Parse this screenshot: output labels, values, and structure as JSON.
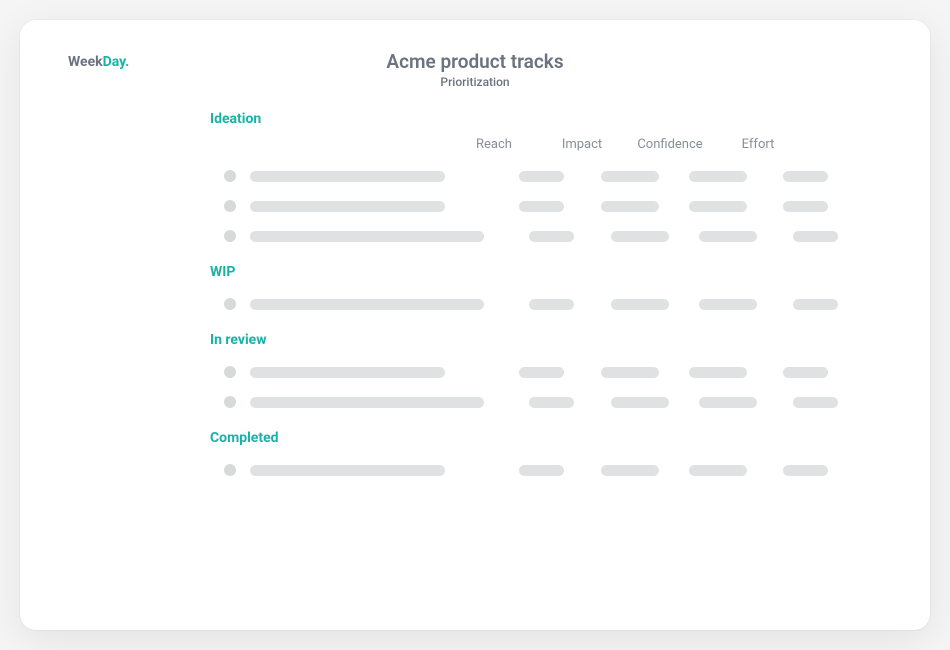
{
  "logo": {
    "week": "Week",
    "day": "Day",
    "dot": "."
  },
  "header": {
    "title": "Acme product tracks",
    "subtitle": "Prioritization"
  },
  "columns": {
    "reach": "Reach",
    "impact": "Impact",
    "confidence": "Confidence",
    "effort": "Effort"
  },
  "sections": [
    {
      "title": "Ideation",
      "rows": 3,
      "long_rows": [
        2
      ]
    },
    {
      "title": "WIP",
      "rows": 1,
      "long_rows": [
        0
      ]
    },
    {
      "title": "In review",
      "rows": 2,
      "long_rows": [
        1
      ]
    },
    {
      "title": "Completed",
      "rows": 1,
      "long_rows": []
    }
  ]
}
